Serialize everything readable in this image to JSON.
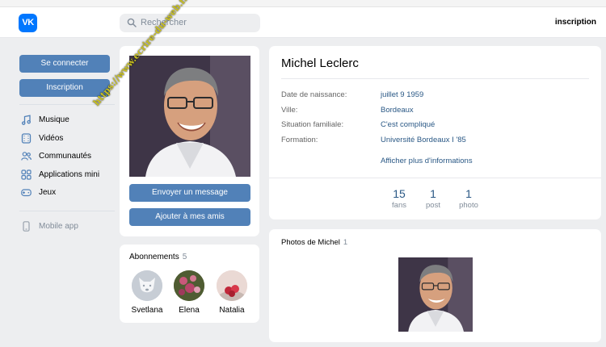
{
  "header": {
    "logo_text": "VK",
    "search_placeholder": "Rechercher",
    "right_link": "inscription",
    "brand_color": "#0077ff"
  },
  "leftnav": {
    "login_label": "Se connecter",
    "signup_label": "Inscription",
    "items": [
      {
        "label": "Musique",
        "icon": "music-note-icon"
      },
      {
        "label": "Vidéos",
        "icon": "video-icon"
      },
      {
        "label": "Communautés",
        "icon": "people-icon"
      },
      {
        "label": "Applications mini",
        "icon": "apps-grid-icon"
      },
      {
        "label": "Jeux",
        "icon": "gamepad-icon"
      }
    ],
    "mobile_label": "Mobile app"
  },
  "profile": {
    "name": "Michel Leclerc",
    "send_message_label": "Envoyer un message",
    "add_friend_label": "Ajouter à mes amis",
    "watermark": "https://www.ecrire-du-web.fr",
    "fields": [
      {
        "label": "Date de naissance:",
        "value": "juillet 9 1959"
      },
      {
        "label": "Ville:",
        "value": "Bordeaux"
      },
      {
        "label": "Situation familiale:",
        "value": "C'est compliqué"
      },
      {
        "label": "Formation:",
        "value": "Université Bordeaux I '85"
      }
    ],
    "more_info_label": "Afficher plus d'informations",
    "stats": [
      {
        "num": "15",
        "caption": "fans"
      },
      {
        "num": "1",
        "caption": "post"
      },
      {
        "num": "1",
        "caption": "photo"
      }
    ]
  },
  "subscriptions": {
    "title": "Abonnements",
    "count": "5",
    "items": [
      {
        "name": "Svetlana"
      },
      {
        "name": "Elena"
      },
      {
        "name": "Natalia"
      }
    ]
  },
  "photos": {
    "title": "Photos de Michel",
    "count": "1"
  },
  "colors": {
    "accent": "#5181b8",
    "link": "#2a5885",
    "background": "#edeef0"
  }
}
